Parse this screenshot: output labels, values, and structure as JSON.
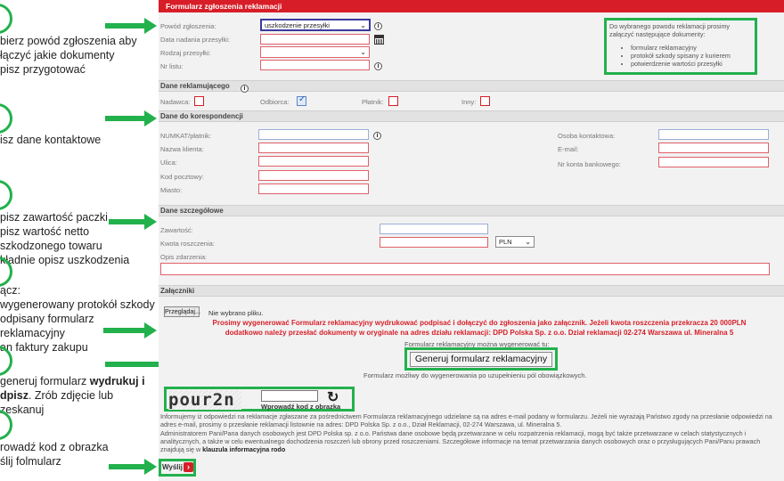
{
  "tutorial": {
    "steps": [
      {
        "lines": [
          "bierz powód zgłoszenia aby",
          "łączyć jakie dokumenty",
          "pisz przygotować"
        ]
      },
      {
        "lines": [
          "isz dane kontaktowe"
        ]
      },
      {
        "lines": [
          "pisz zawartość paczki",
          "pisz wartość netto",
          "szkodzonego towaru",
          "kładnie opisz uszkodzenia"
        ]
      },
      {
        "lines": [
          "ącz:",
          "wygenerowany protokół szkody",
          "odpisany formularz reklamacyjny",
          "an faktury zakupu"
        ]
      },
      {
        "line1_plain": "generuj formularz ",
        "line1_bold": "wydrukuj i",
        "line2_bold": "dpisz",
        "line2_plain": ". Zrób zdjęcie lub zeskanuj"
      },
      {
        "lines": [
          "rowadź kod z obrazka",
          "ślij folmularz"
        ]
      }
    ]
  },
  "form": {
    "title": "Formularz zgłoszenia reklamacji",
    "reason_label": "Powód zgłoszenia:",
    "reason_value": "uszkodzenie przesyłki",
    "send_date_label": "Data nadania przesyłki:",
    "parcel_type_label": "Rodzaj przesyłki:",
    "waybill_label": "Nr listu:",
    "docs": {
      "intro": "Do wybranego powodu reklamacji prosimy załączyć następujące dokumenty:",
      "items": [
        "formularz reklamacyjny",
        "protokół szkody spisany z kurierem",
        "potwierdzenie wartości przesyłki"
      ]
    },
    "claimant": {
      "title": "Dane reklamującego",
      "sender": "Nadawca:",
      "recipient": "Odbiorca:",
      "payer": "Płatnik:",
      "other": "Inny:"
    },
    "contact": {
      "title": "Dane do korespondencji",
      "numkat": "NUMKAT/płatnik:",
      "client": "Nazwa klienta:",
      "street": "Ulica:",
      "postcode": "Kod pocztowy:",
      "city": "Miasto:",
      "person": "Osoba kontaktowa:",
      "email": "E-mail:",
      "account": "Nr konta bankowego:"
    },
    "details": {
      "title": "Dane szczegółowe",
      "content": "Zawartość:",
      "amount": "Kwota roszczenia:",
      "currency": "PLN",
      "description": "Opis zdarzenia:"
    },
    "attachments": {
      "title": "Załączniki",
      "browse": "Przeglądaj...",
      "no_file": "Nie wybrano pliku.",
      "warning_1": "Prosimy wygenerować Formularz reklamacyjny wydrukować podpisać i dołączyć do zgłoszenia jako załącznik. Jeżeli kwota roszczenia przekracza 20 000PLN",
      "warning_2": "dodatkowo należy przesłać dokumenty w oryginale na adres działu reklamacji: DPD Polska Sp. z o.o. Dział reklamacji 02-274 Warszawa ul. Mineralna 5",
      "gen_above": "Formularz reklamacyjny można wygenerować tu:",
      "gen_button": "Generuj formularz reklamacyjny",
      "gen_below": "Formularz możliwy do wygenerowania po uzupełnieniu pól obowiązkowych."
    },
    "captcha": {
      "code": "pour2n",
      "label": "Wprowadź kod z obrazka"
    },
    "legal": {
      "p1": "Informujemy iż odpowiedzi na reklamacje zgłaszane za pośrednictwem Formularza reklamacyjnego udzielane są na adres e-mail podany w formularzu. Jeżeli nie wyrażają Państwo zgody na przesłanie odpowiedzi na adres e-mail, prosimy o przesłanie reklamacji listownie na adres: DPD Polska Sp. z o.o., Dział Reklamacji, 02-274 Warszawa, ul. Mineralna 5.",
      "p2": "Administratorem Pani/Pana danych osobowych jest DPD Polska sp. z o.o. Państwa dane osobowe będą przetwarzane w celu rozpatrzenia reklamacji, mogą być także przetwarzane w celach statystycznych i analitycznych, a także w celu ewentualnego dochodzenia roszczeń lub obrony przed roszczeniami. Szczegółowe informacje na temat przetwarzania danych osobowych oraz o przysługujących Pani/Panu prawach znajdują się w ",
      "p2_bold": "klauzula informacyjna rodo"
    },
    "send_label": "Wyślij"
  },
  "colors": {
    "accent": "#d71e28",
    "highlight": "#22b14c"
  }
}
